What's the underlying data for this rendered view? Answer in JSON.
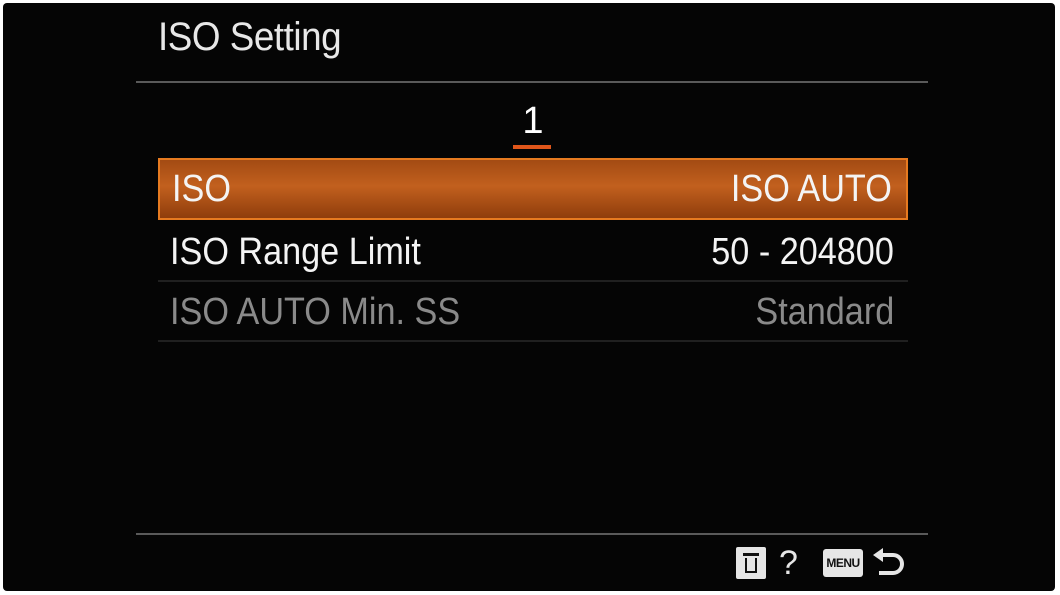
{
  "header": {
    "title": "ISO Setting",
    "page_number": "1"
  },
  "menu": {
    "items": [
      {
        "label": "ISO",
        "value": "ISO AUTO",
        "state": "selected"
      },
      {
        "label": "ISO Range Limit",
        "value": "50 - 204800",
        "state": "normal"
      },
      {
        "label": "ISO AUTO Min. SS",
        "value": "Standard",
        "state": "disabled"
      }
    ]
  },
  "footer": {
    "delete_icon": "trash-icon",
    "help_label": "?",
    "menu_button_label": "MENU",
    "back_icon": "return-arrow-icon"
  },
  "colors": {
    "background": "#050505",
    "highlight": "#c2601e",
    "highlight_border": "#e67a20",
    "text": "#f4f4f4",
    "disabled_text": "#8a8a8a"
  }
}
